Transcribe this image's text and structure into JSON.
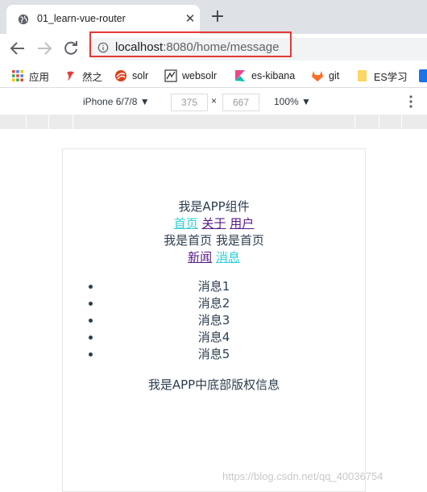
{
  "tab": {
    "title": "01_learn-vue-router",
    "close": "✕",
    "new_tab": "+"
  },
  "toolbar": {
    "url_host": "localhost",
    "url_path": ":8080/home/message"
  },
  "bookmarks": [
    {
      "label": "应用",
      "icon": "apps-grid-icon"
    },
    {
      "label": "然之",
      "icon": "ranzhi-icon"
    },
    {
      "label": "solr",
      "icon": "solr-icon"
    },
    {
      "label": "websolr",
      "icon": "websolr-icon"
    },
    {
      "label": "es-kibana",
      "icon": "kibana-icon"
    },
    {
      "label": "git",
      "icon": "gitlab-icon"
    },
    {
      "label": "ES学习",
      "icon": "folder-icon"
    }
  ],
  "device_toolbar": {
    "device": "iPhone 6/7/8",
    "width": "375",
    "times": "×",
    "height": "667",
    "zoom": "100%"
  },
  "app": {
    "header": "我是APP组件",
    "nav": [
      "首页",
      "关于",
      "用户"
    ],
    "home_text": "我是首页 我是首页",
    "subnav": [
      "新闻",
      "消息"
    ],
    "messages": [
      "消息1",
      "消息2",
      "消息3",
      "消息4",
      "消息5"
    ],
    "footer": "我是APP中底部版权信息"
  },
  "watermark": "https://blog.csdn.net/qq_40036754",
  "colors": {
    "active_link": "#2cd0d6",
    "visited_link": "#551a8b",
    "text": "#2c3e50",
    "highlight_box": "#e53935"
  }
}
